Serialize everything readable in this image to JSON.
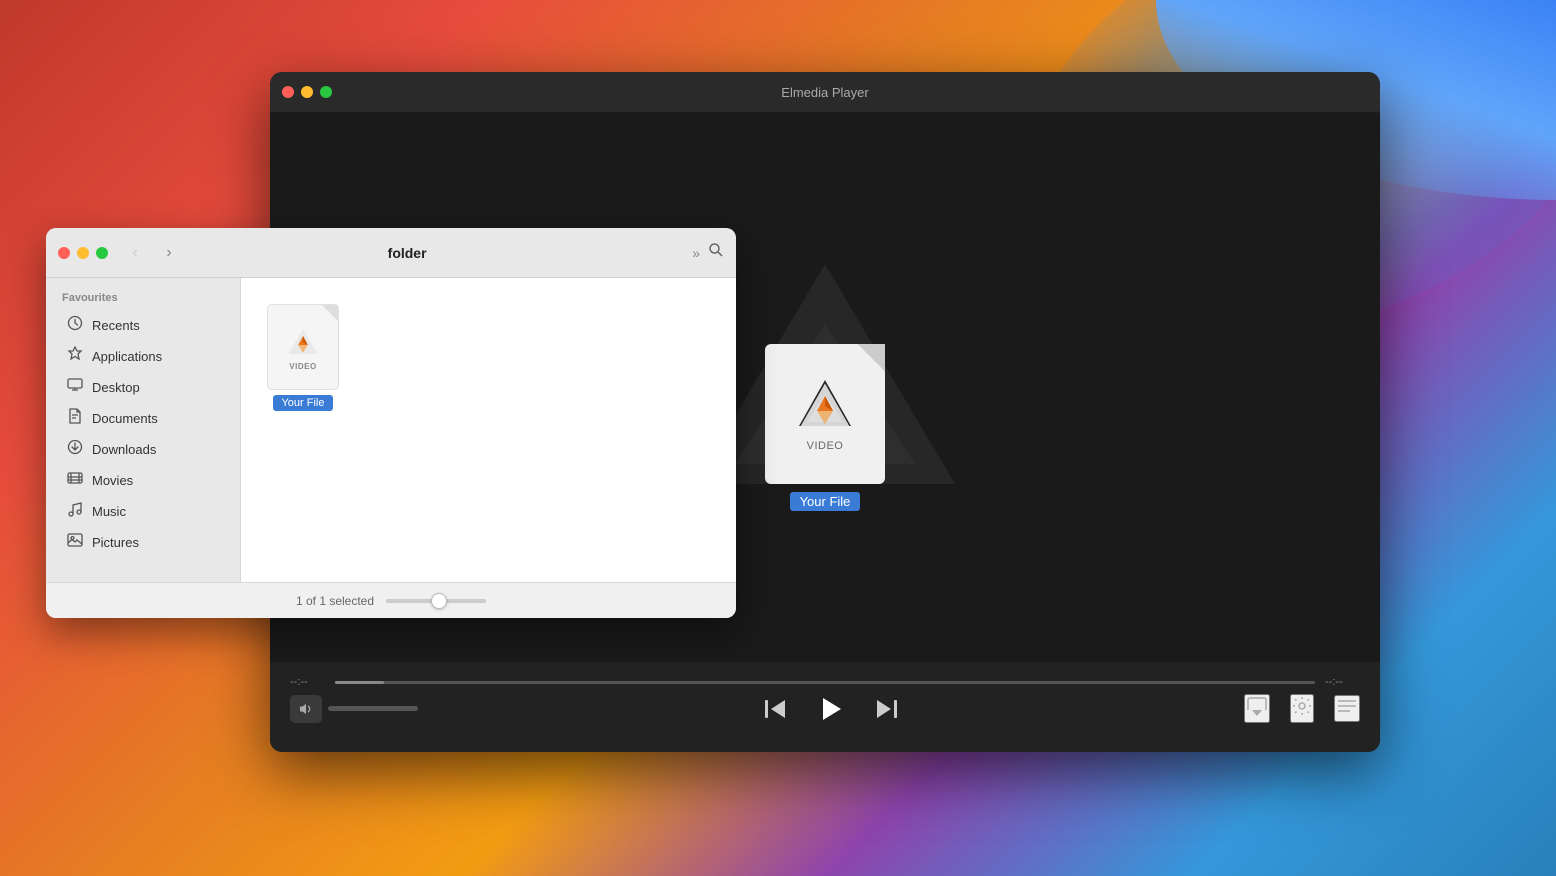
{
  "background": {
    "gradient": "macOS Big Sur wallpaper gradient"
  },
  "player": {
    "title": "Elmedia Player",
    "window_controls": {
      "close": "close",
      "minimize": "minimize",
      "maximize": "maximize"
    },
    "file_icon": {
      "label": "VIDEO",
      "name": "Your File"
    },
    "controls": {
      "time_start": "--:--",
      "time_end": "--:--",
      "prev_label": "⏮",
      "play_label": "▶",
      "next_label": "⏭",
      "airplay_label": "airplay",
      "settings_label": "settings",
      "playlist_label": "playlist"
    }
  },
  "finder": {
    "title": "folder",
    "window_controls": {
      "close": "close",
      "minimize": "minimize",
      "maximize": "maximize"
    },
    "nav": {
      "back": "‹",
      "forward": "›",
      "more": "»",
      "search": "search"
    },
    "sidebar": {
      "section_title": "Favourites",
      "items": [
        {
          "id": "recents",
          "label": "Recents",
          "icon": "🕐"
        },
        {
          "id": "applications",
          "label": "Applications",
          "icon": "🚀"
        },
        {
          "id": "desktop",
          "label": "Desktop",
          "icon": "🖥"
        },
        {
          "id": "documents",
          "label": "Documents",
          "icon": "📄"
        },
        {
          "id": "downloads",
          "label": "Downloads",
          "icon": "⬇"
        },
        {
          "id": "movies",
          "label": "Movies",
          "icon": "🎞"
        },
        {
          "id": "music",
          "label": "Music",
          "icon": "♪"
        },
        {
          "id": "pictures",
          "label": "Pictures",
          "icon": "🖼"
        }
      ]
    },
    "file": {
      "label": "VIDEO",
      "name": "Your File"
    },
    "statusbar": {
      "text": "1 of 1 selected"
    }
  }
}
